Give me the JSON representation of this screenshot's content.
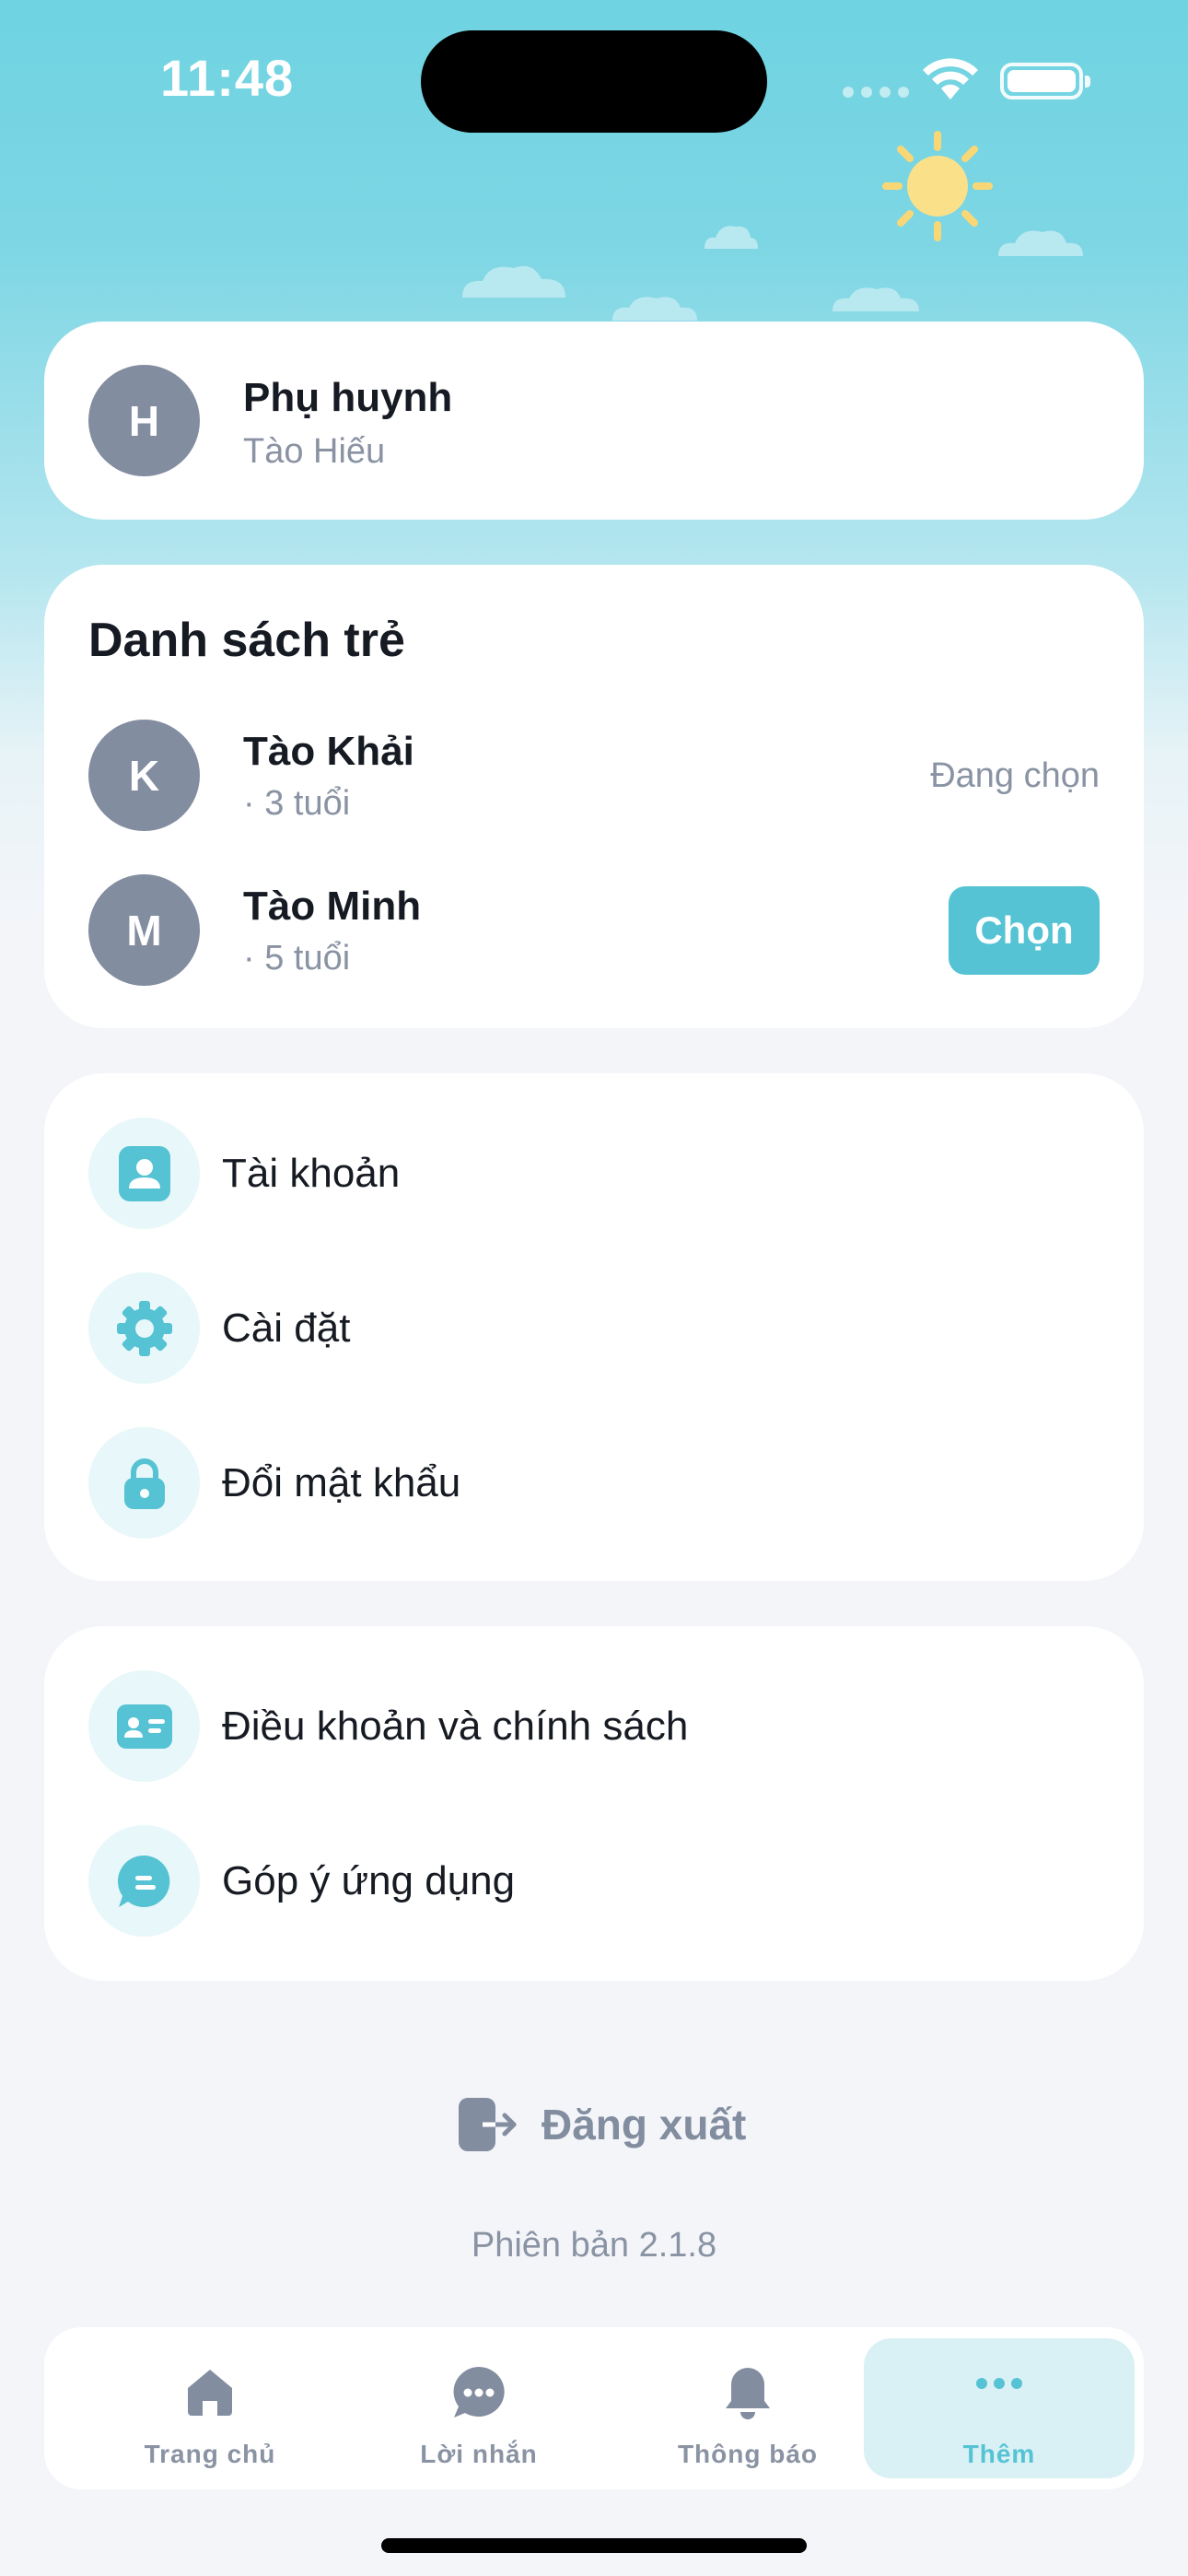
{
  "status_bar": {
    "time": "11:48"
  },
  "colors": {
    "accent": "#55c3d4",
    "avatar": "#838da0",
    "sky_top": "#6fd3e1",
    "background": "#f3f5f9",
    "text_primary": "#161a22",
    "text_secondary": "#8a93a3"
  },
  "parent": {
    "avatar_letter": "H",
    "role": "Phụ huynh",
    "name": "Tào Hiếu"
  },
  "children": {
    "title": "Danh sách trẻ",
    "items": [
      {
        "avatar_letter": "K",
        "name": "Tào Khải",
        "age": "· 3 tuổi",
        "status": "Đang chọn"
      },
      {
        "avatar_letter": "M",
        "name": "Tào Minh",
        "age": "· 5 tuổi",
        "action": "Chọn"
      }
    ]
  },
  "menu": {
    "items": [
      {
        "label": "Tài khoản",
        "icon": "account-icon"
      },
      {
        "label": "Cài đặt",
        "icon": "gear-icon"
      },
      {
        "label": "Đổi mật khẩu",
        "icon": "lock-icon"
      }
    ]
  },
  "legal": {
    "items": [
      {
        "label": "Điều khoản và chính sách",
        "icon": "id-card-icon"
      },
      {
        "label": "Góp ý ứng dụng",
        "icon": "feedback-icon"
      }
    ]
  },
  "logout": {
    "label": "Đăng xuất",
    "icon": "logout-icon"
  },
  "version": "Phiên bản 2.1.8",
  "tabbar": {
    "tabs": [
      {
        "label": "Trang chủ",
        "icon": "home-icon"
      },
      {
        "label": "Lời nhắn",
        "icon": "chat-icon"
      },
      {
        "label": "Thông báo",
        "icon": "bell-icon"
      },
      {
        "label": "Thêm",
        "icon": "more-icon",
        "active": true
      }
    ]
  }
}
